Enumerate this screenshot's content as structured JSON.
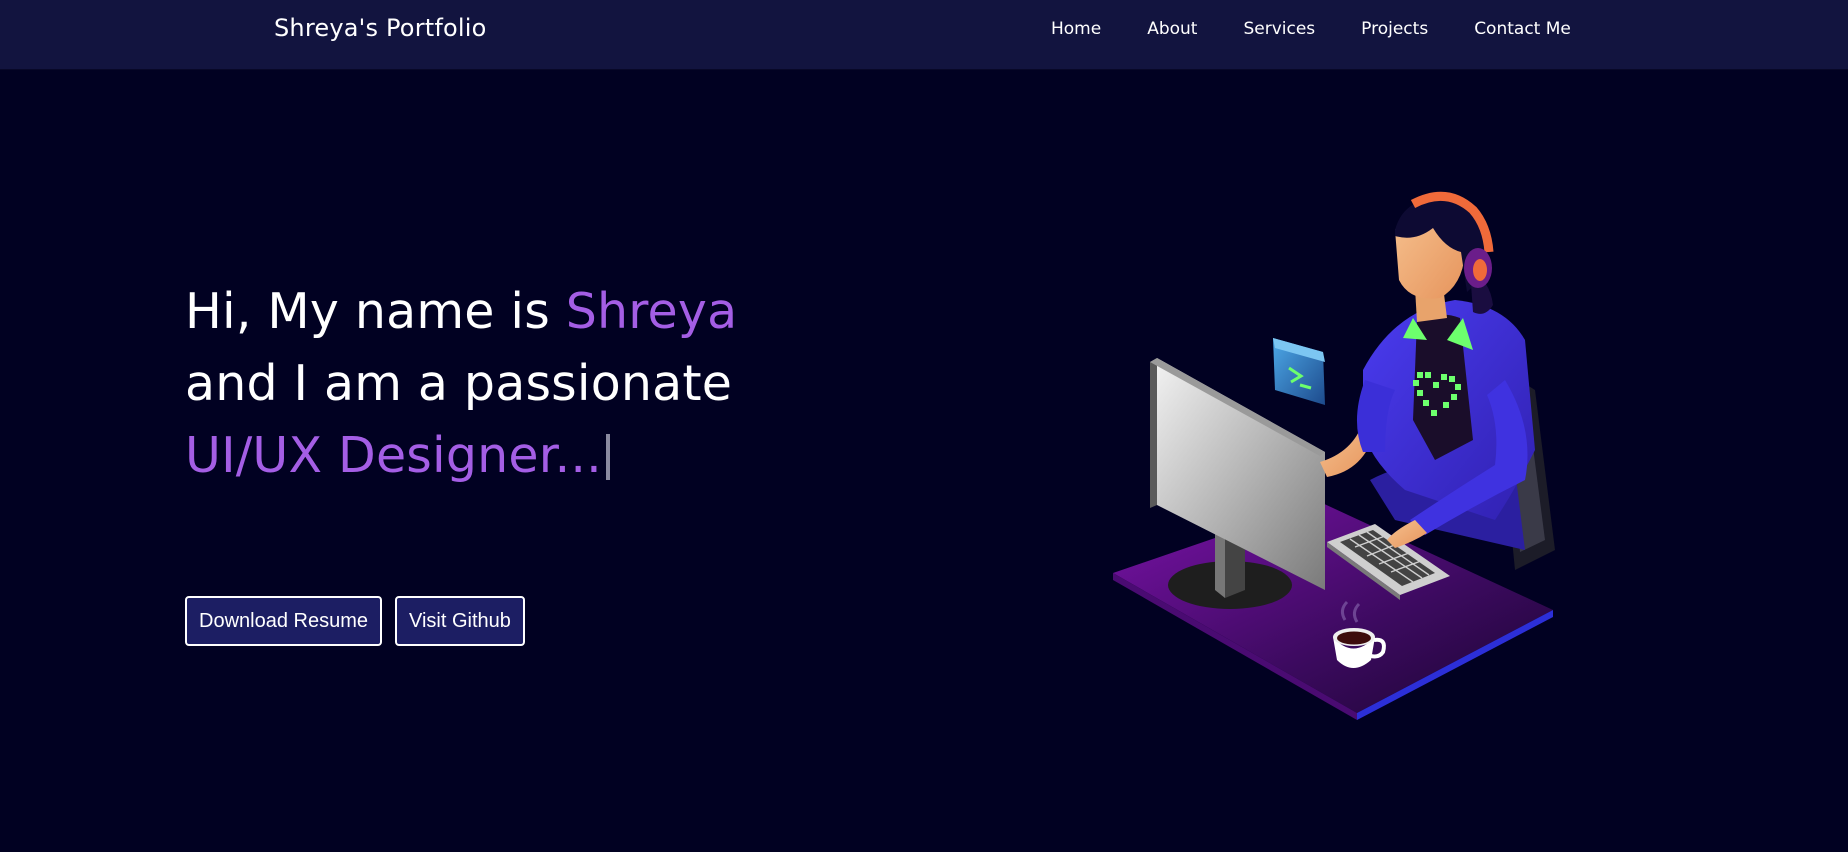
{
  "brand": "Shreya's Portfolio",
  "nav": {
    "items": [
      {
        "label": "Home"
      },
      {
        "label": "About"
      },
      {
        "label": "Services"
      },
      {
        "label": "Projects"
      },
      {
        "label": "Contact Me"
      }
    ]
  },
  "hero": {
    "greeting": "Hi, My name is ",
    "name": "Shreya",
    "line2": "and I am a passionate",
    "role": "UI/UX Designer..."
  },
  "buttons": {
    "resume": "Download Resume",
    "github": "Visit Github"
  },
  "colors": {
    "background": "#010122",
    "navbar": "#12143f",
    "accent": "#a45ee5",
    "button_bg": "#1c1e63"
  },
  "illustration": {
    "icons": [
      "person-at-computer-icon",
      "terminal-window-icon",
      "coffee-cup-icon"
    ]
  }
}
